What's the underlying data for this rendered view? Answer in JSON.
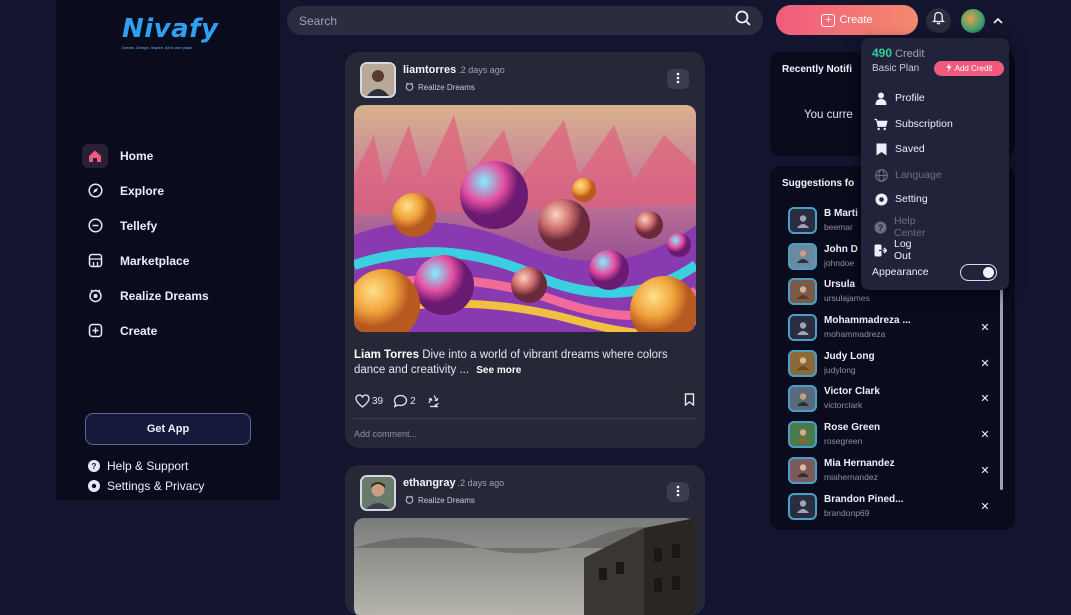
{
  "brand": {
    "name": "Nivafy",
    "tagline": "Dream. Design. Inspire. All in one place"
  },
  "nav": {
    "items": [
      {
        "label": "Home",
        "icon": "home-icon",
        "active": true
      },
      {
        "label": "Explore",
        "icon": "compass-icon"
      },
      {
        "label": "Tellefy",
        "icon": "chat-icon"
      },
      {
        "label": "Marketplace",
        "icon": "store-icon"
      },
      {
        "label": "Realize Dreams",
        "icon": "dream-icon"
      },
      {
        "label": "Create",
        "icon": "plus-square-icon"
      }
    ],
    "get_app": "Get App",
    "footer": [
      {
        "label": "Help & Support",
        "icon": "help-icon"
      },
      {
        "label": "Settings & Privacy",
        "icon": "settings-icon"
      }
    ]
  },
  "topbar": {
    "search_placeholder": "Search",
    "create_label": "Create"
  },
  "posts": [
    {
      "username": "liamtorres",
      "time": ".2 days ago",
      "tag": "Realize Dreams",
      "author": "Liam Torres",
      "caption": "Dive into a world of vibrant dreams where colors dance and creativity ...",
      "see_more": "See more",
      "likes": "39",
      "comments": "2",
      "add_comment": "Add comment..."
    },
    {
      "username": "ethangray",
      "time": ".2 days ago",
      "tag": "Realize Dreams"
    }
  ],
  "notifications": {
    "title": "Recently Notifi",
    "empty_text": "You curre"
  },
  "suggestions": {
    "title": "Suggestions fo",
    "items": [
      {
        "name": "B Marti",
        "handle": "beemar"
      },
      {
        "name": "John D",
        "handle": "johndoe"
      },
      {
        "name": "Ursula",
        "handle": "ursulajames"
      },
      {
        "name": "Mohammadreza ...",
        "handle": "mohammadreza"
      },
      {
        "name": "Judy Long",
        "handle": "judylong"
      },
      {
        "name": "Victor Clark",
        "handle": "victorclark"
      },
      {
        "name": "Rose Green",
        "handle": "rosegreen"
      },
      {
        "name": "Mia Hernandez",
        "handle": "miahernandez"
      },
      {
        "name": "Brandon Pined...",
        "handle": "brandonp69"
      }
    ]
  },
  "account_menu": {
    "credit_value": "490",
    "credit_label": "Credit",
    "plan": "Basic Plan",
    "add_credit": "Add Credit",
    "items": [
      {
        "label": "Profile",
        "icon": "user-icon"
      },
      {
        "label": "Subscription",
        "icon": "cart-icon"
      },
      {
        "label": "Saved",
        "icon": "bookmark-icon"
      },
      {
        "label": "Language",
        "icon": "globe-icon",
        "disabled": true
      },
      {
        "label": "Setting",
        "icon": "gear-icon"
      },
      {
        "label": "Help Center",
        "icon": "help-icon",
        "disabled": true
      },
      {
        "label": "Log Out",
        "icon": "logout-icon"
      }
    ],
    "appearance": "Appearance",
    "appearance_dark": true
  },
  "colors": {
    "accent": "#f05b7d",
    "credit": "#30d09a",
    "brand": "#2fa0f0"
  }
}
